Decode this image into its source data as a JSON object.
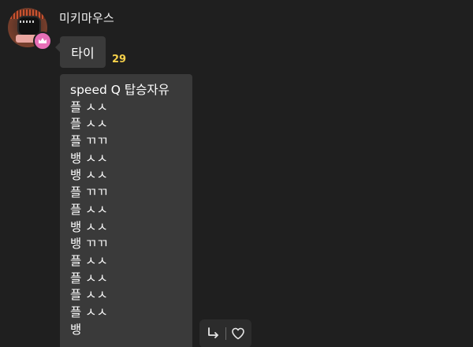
{
  "sender": {
    "name": "미키마우스"
  },
  "messages": {
    "first": {
      "text": "타이",
      "unread_count": "29",
      "unread_color": "#f5d04a"
    },
    "second": {
      "lines": [
        "speed Q 탑승자유",
        "플 ㅅㅅ",
        "플 ㅅㅅ",
        "플 ㄲㄲ",
        "뱅 ㅅㅅ",
        "뱅 ㅅㅅ",
        "플 ㄲㄲ",
        "플 ㅅㅅ",
        "뱅 ㅅㅅ",
        "뱅 ㄲㄲ",
        "플 ㅅㅅ",
        "플 ㅅㅅ",
        "플 ㅅㅅ",
        "플 ㅅㅅ",
        "뱅"
      ]
    }
  },
  "icons": {
    "avatar": "profile-avatar",
    "badge": "crown-icon",
    "reply": "reply-arrow-icon",
    "like": "heart-icon"
  },
  "colors": {
    "background": "#1f1f1f",
    "bubble": "#3a3a3a",
    "badge": "#e86fb7"
  }
}
